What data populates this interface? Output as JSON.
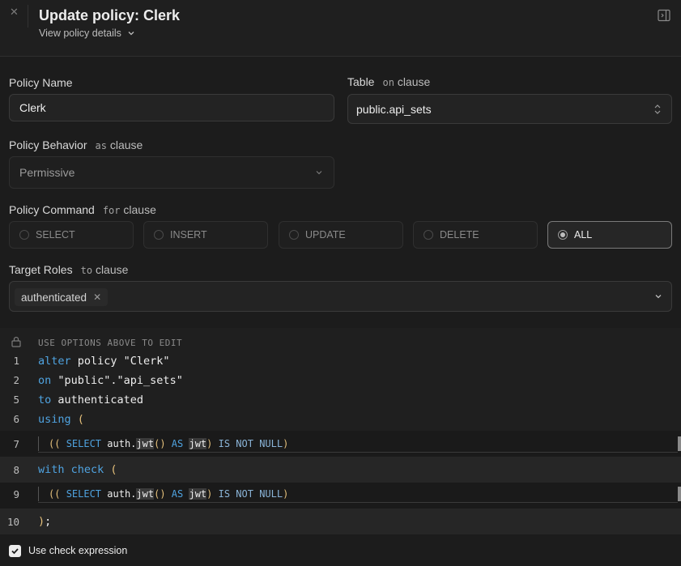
{
  "header": {
    "title": "Update policy: Clerk",
    "view_details": "View policy details"
  },
  "form": {
    "policy_name": {
      "label": "Policy Name",
      "value": "Clerk"
    },
    "table": {
      "label": "Table",
      "clause_prefix": "on",
      "clause": "clause",
      "value": "public.api_sets"
    },
    "behavior": {
      "label": "Policy Behavior",
      "clause_prefix": "as",
      "clause": "clause",
      "value": "Permissive"
    },
    "command": {
      "label": "Policy Command",
      "clause_prefix": "for",
      "clause": "clause",
      "options": [
        "SELECT",
        "INSERT",
        "UPDATE",
        "DELETE",
        "ALL"
      ],
      "selected": "ALL"
    },
    "roles": {
      "label": "Target Roles",
      "clause_prefix": "to",
      "clause": "clause",
      "chips": [
        "authenticated"
      ]
    }
  },
  "editor": {
    "hint": "USE OPTIONS ABOVE TO EDIT",
    "lines": {
      "l1": {
        "num": "1",
        "kw": "alter",
        "rest": " policy \"Clerk\""
      },
      "l2": {
        "num": "2",
        "kw": "on",
        "rest": " \"public\".\"api_sets\""
      },
      "l3": {
        "num": "5",
        "kw": "to",
        "rest": " authenticated"
      },
      "l4": {
        "num": "6",
        "kw": "using",
        "paren": "("
      },
      "l7": {
        "num": "7"
      },
      "l8": {
        "num": "8",
        "kw": "with check",
        "paren": "("
      },
      "l9": {
        "num": "9"
      },
      "l10": {
        "num": "10",
        "paren": ")",
        "rest": ";"
      }
    },
    "expr": {
      "open": "((",
      "select": "SELECT",
      "fn_prefix": "auth.",
      "fn": "jwt",
      "fn_parens": "()",
      "as": "AS",
      "alias": "jwt",
      "close": ")",
      "is_not_null": "IS NOT NULL",
      "close2": ")"
    }
  },
  "footer": {
    "checkbox_label": "Use check expression",
    "checked": true
  }
}
